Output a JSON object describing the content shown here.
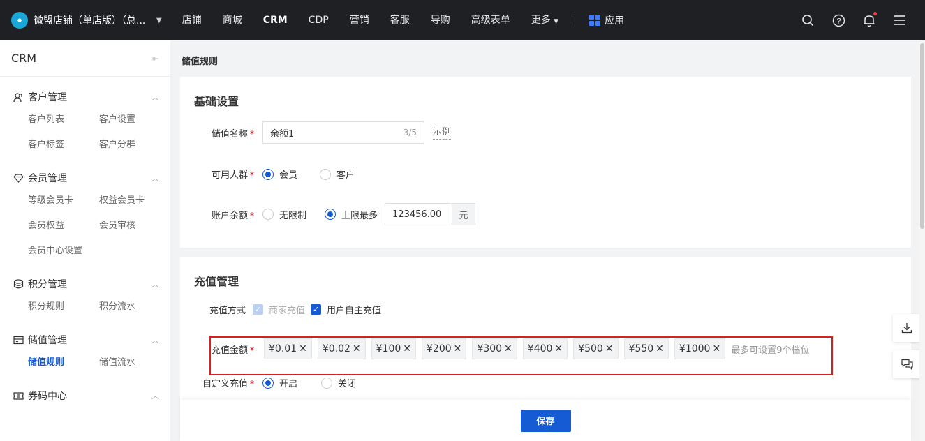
{
  "topbar": {
    "store_name": "微盟店铺（单店版）（总...",
    "nav": [
      "店铺",
      "商城",
      "CRM",
      "CDP",
      "营销",
      "客服",
      "导购",
      "高级表单"
    ],
    "more_label": "更多",
    "apps_label": "应用"
  },
  "sidebar": {
    "title": "CRM",
    "groups": [
      {
        "title": "客户管理",
        "items": [
          "客户列表",
          "客户设置",
          "客户标签",
          "客户分群"
        ]
      },
      {
        "title": "会员管理",
        "items": [
          "等级会员卡",
          "权益会员卡",
          "会员权益",
          "会员审核",
          "会员中心设置"
        ]
      },
      {
        "title": "积分管理",
        "items": [
          "积分规则",
          "积分流水"
        ]
      },
      {
        "title": "储值管理",
        "items": [
          "储值规则",
          "储值流水"
        ]
      },
      {
        "title": "券码中心",
        "items": []
      }
    ]
  },
  "main": {
    "breadcrumb": "储值规则",
    "basic": {
      "title": "基础设置",
      "name_label": "储值名称",
      "name_value": "余额1",
      "name_count": "3/5",
      "example_link": "示例",
      "audience_label": "可用人群",
      "audience_options": [
        "会员",
        "客户"
      ],
      "balance_label": "账户余额",
      "balance_options": [
        "无限制",
        "上限最多"
      ],
      "balance_value": "123456.00",
      "balance_unit": "元"
    },
    "recharge": {
      "title": "充值管理",
      "method_label": "充值方式",
      "method_options": [
        "商家充值",
        "用户自主充值"
      ],
      "amount_label": "充值金额",
      "amounts": [
        "¥0.01",
        "¥0.02",
        "¥100",
        "¥200",
        "¥300",
        "¥400",
        "¥500",
        "¥550",
        "¥1000"
      ],
      "amount_hint": "最多可设置9个档位",
      "custom_label": "自定义充值",
      "custom_options": [
        "开启",
        "关闭"
      ]
    },
    "save_label": "保存"
  },
  "colors": {
    "accent": "#155bd4",
    "highlight_border": "#d91f1f",
    "topbar": "#1f2024"
  }
}
